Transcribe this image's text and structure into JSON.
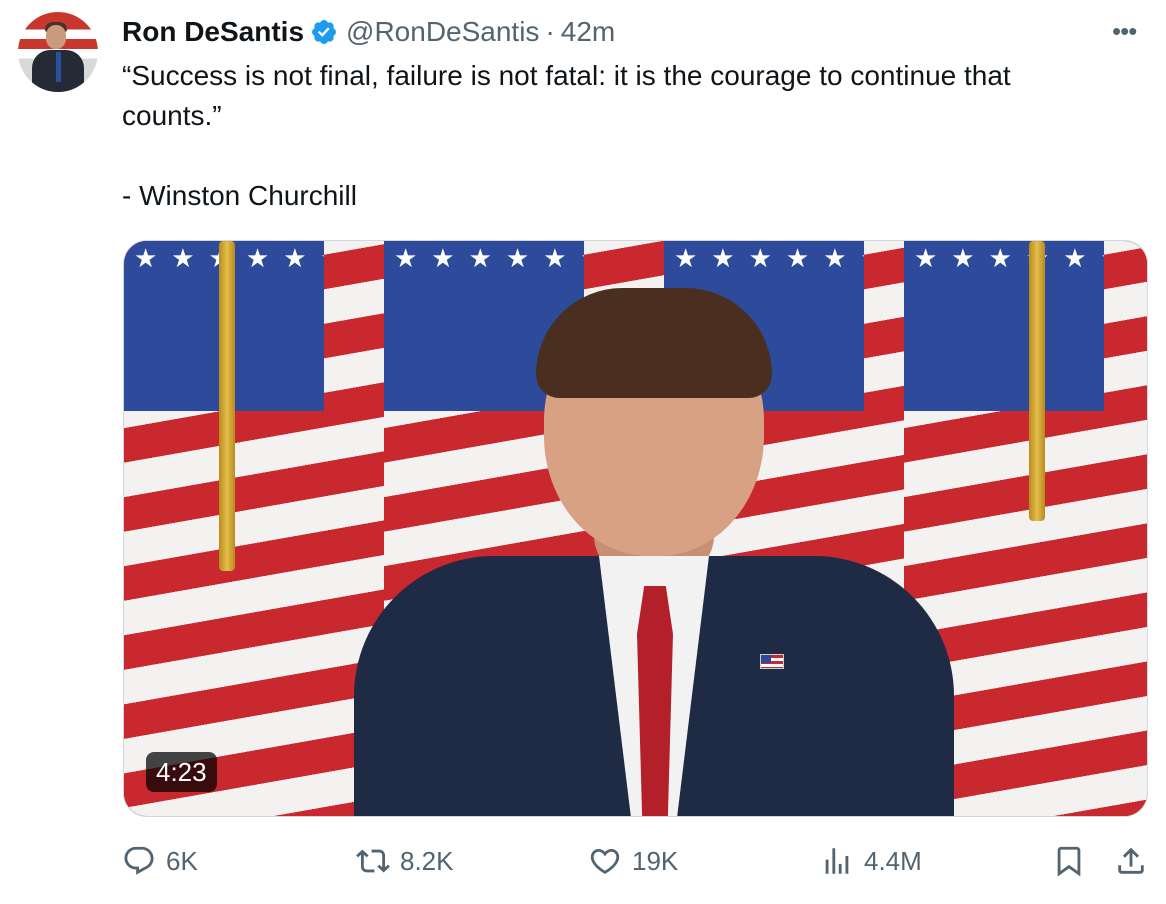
{
  "author": {
    "name": "Ron DeSantis",
    "handle": "@RonDeSantis",
    "separator": "·",
    "time": "42m"
  },
  "more_label": "•••",
  "tweet": {
    "lines": [
      "“Success is not final, failure is not fatal: it is the courage to continue that",
      "counts.”",
      "- Winston Churchill"
    ]
  },
  "media": {
    "duration": "4:23"
  },
  "actions": {
    "replies": "6K",
    "reposts": "8.2K",
    "likes": "19K",
    "views": "4.4M"
  },
  "colors": {
    "verified": "#1d9bf0",
    "secondary_text": "#536471",
    "primary_text": "#0f1419"
  },
  "icons": [
    "verified-badge-icon",
    "more-icon",
    "reply-icon",
    "repost-icon",
    "like-icon",
    "views-icon",
    "bookmark-icon",
    "share-icon"
  ]
}
